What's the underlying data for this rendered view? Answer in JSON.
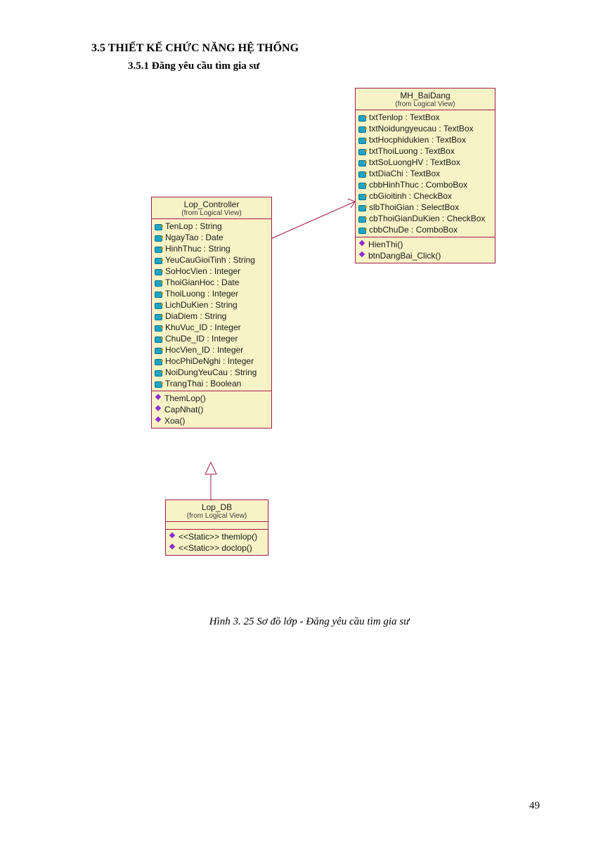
{
  "headings": {
    "section": "3.5    THIẾT KẾ CHỨC NĂNG HỆ THỐNG",
    "subsection": "3.5.1   Đăng yêu cầu tìm gia sư"
  },
  "caption": "Hình 3. 25 Sơ đồ lớp - Đăng yêu cầu tìm gia sư",
  "page_number": "49",
  "classes": {
    "lop_controller": {
      "title": "Lop_Controller",
      "subtitle": "(from Logical View)",
      "attrs": [
        "TenLop : String",
        "NgayTao : Date",
        "HinhThuc : String",
        "YeuCauGioiTinh : String",
        "SoHocVien : Integer",
        "ThoiGianHoc : Date",
        "ThoiLuong : Integer",
        "LichDuKien : String",
        "DiaDiem : String",
        "KhuVuc_ID : Integer",
        "ChuDe_ID : Integer",
        "HocVien_ID : Integer",
        "HocPhiDeNghi : Integer",
        "NoiDungYeuCau : String",
        "TrangThai : Boolean"
      ],
      "ops": [
        "ThemLop()",
        "CapNhat()",
        "Xoa()"
      ]
    },
    "mh_baidang": {
      "title": "MH_BaiDang",
      "subtitle": "(from Logical View)",
      "attrs": [
        "txtTenlop : TextBox",
        "txtNoidungyeucau : TextBox",
        "txtHocphidukien : TextBox",
        "txtThoiLuong : TextBox",
        "txtSoLuongHV : TextBox",
        "txtDiaChi : TextBox",
        "cbbHinhThuc : ComboBox",
        "cbGioitinh : CheckBox",
        "slbThoiGian : SelectBox",
        "cbThoiGianDuKien : CheckBox",
        "cbbChuDe : ComboBox"
      ],
      "ops": [
        "HienThi()",
        "btnDangBai_Click()"
      ]
    },
    "lop_db": {
      "title": "Lop_DB",
      "subtitle": "(from Logical View)",
      "attrs_empty": "",
      "ops": [
        "<<Static>> themlop()",
        "<<Static>> doclop()"
      ]
    }
  }
}
